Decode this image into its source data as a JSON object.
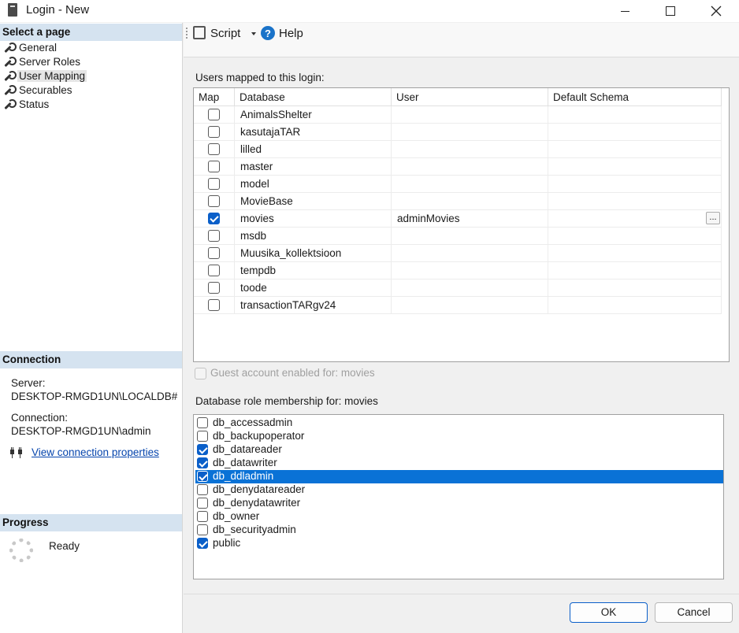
{
  "window": {
    "title": "Login - New"
  },
  "left": {
    "select_page_header": "Select a page",
    "pages": [
      {
        "label": "General"
      },
      {
        "label": "Server Roles"
      },
      {
        "label": "User Mapping",
        "selected": true
      },
      {
        "label": "Securables"
      },
      {
        "label": "Status"
      }
    ],
    "connection_header": "Connection",
    "server_label": "Server:",
    "server_value": "DESKTOP-RMGD1UN\\LOCALDB#",
    "connection_label": "Connection:",
    "connection_value": "DESKTOP-RMGD1UN\\admin",
    "view_props_link": "View connection properties",
    "progress_header": "Progress",
    "progress_status": "Ready"
  },
  "toolbar": {
    "script_label": "Script",
    "help_label": "Help"
  },
  "mapping": {
    "label": "Users mapped to this login:",
    "columns": [
      "Map",
      "Database",
      "User",
      "Default Schema"
    ],
    "rows": [
      {
        "map": false,
        "database": "AnimalsShelter",
        "user": "",
        "schema": ""
      },
      {
        "map": false,
        "database": "kasutajaTAR",
        "user": "",
        "schema": ""
      },
      {
        "map": false,
        "database": "lilled",
        "user": "",
        "schema": ""
      },
      {
        "map": false,
        "database": "master",
        "user": "",
        "schema": ""
      },
      {
        "map": false,
        "database": "model",
        "user": "",
        "schema": ""
      },
      {
        "map": false,
        "database": "MovieBase",
        "user": "",
        "schema": ""
      },
      {
        "map": true,
        "database": "movies",
        "user": "adminMovies",
        "schema": ""
      },
      {
        "map": false,
        "database": "msdb",
        "user": "",
        "schema": ""
      },
      {
        "map": false,
        "database": "Muusika_kollektsioon",
        "user": "",
        "schema": ""
      },
      {
        "map": false,
        "database": "tempdb",
        "user": "",
        "schema": ""
      },
      {
        "map": false,
        "database": "toode",
        "user": "",
        "schema": ""
      },
      {
        "map": false,
        "database": "transactionTARgv24",
        "user": "",
        "schema": ""
      }
    ],
    "ellipsis": "..."
  },
  "guest": {
    "label": "Guest account enabled for: movies",
    "checked": false
  },
  "roles": {
    "label": "Database role membership for: movies",
    "items": [
      {
        "name": "db_accessadmin",
        "checked": false
      },
      {
        "name": "db_backupoperator",
        "checked": false
      },
      {
        "name": "db_datareader",
        "checked": true
      },
      {
        "name": "db_datawriter",
        "checked": true
      },
      {
        "name": "db_ddladmin",
        "checked": true,
        "selected": true
      },
      {
        "name": "db_denydatareader",
        "checked": false
      },
      {
        "name": "db_denydatawriter",
        "checked": false
      },
      {
        "name": "db_owner",
        "checked": false
      },
      {
        "name": "db_securityadmin",
        "checked": false
      },
      {
        "name": "public",
        "checked": true
      }
    ]
  },
  "footer": {
    "ok_label": "OK",
    "cancel_label": "Cancel"
  }
}
